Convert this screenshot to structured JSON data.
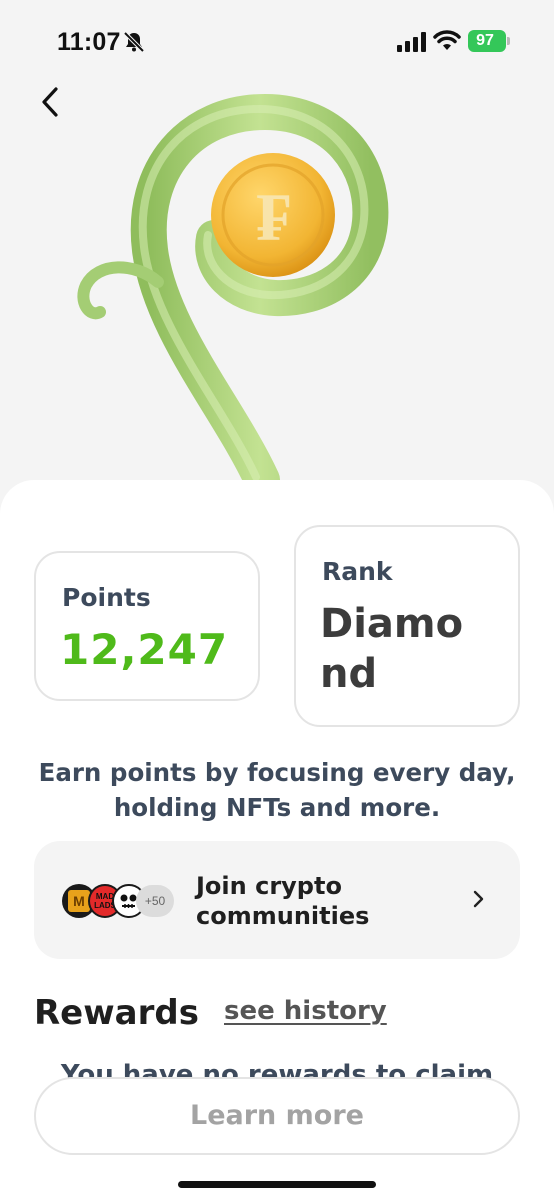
{
  "status_bar": {
    "time": "11:07",
    "battery": "97",
    "icons": [
      "bell-slash-icon",
      "cellular-signal-icon",
      "wifi-icon",
      "battery-icon"
    ]
  },
  "nav": {
    "back_icon": "chevron-left-icon"
  },
  "hero": {
    "image": "sprout-with-gold-coin-illustration"
  },
  "points": {
    "label": "Points",
    "value": "12,247"
  },
  "rank": {
    "label": "Rank",
    "value": "Diamond"
  },
  "earn_text": "Earn points by focusing every day, holding NFTs and more.",
  "communities": {
    "label": "Join crypto communities",
    "extra_count": "+50",
    "avatar_texts": [
      "M",
      "MAD LADS"
    ]
  },
  "rewards": {
    "title": "Rewards",
    "history_link": "see history",
    "empty_message": "You have no rewards to claim"
  },
  "learn_more_button": "Learn more",
  "colors": {
    "points_green": "#4fba1a",
    "label_slate": "#3d4a5c",
    "battery_green": "#34c759",
    "coin_gold": "#f2b533",
    "sprout_green": "#a8d07a"
  }
}
